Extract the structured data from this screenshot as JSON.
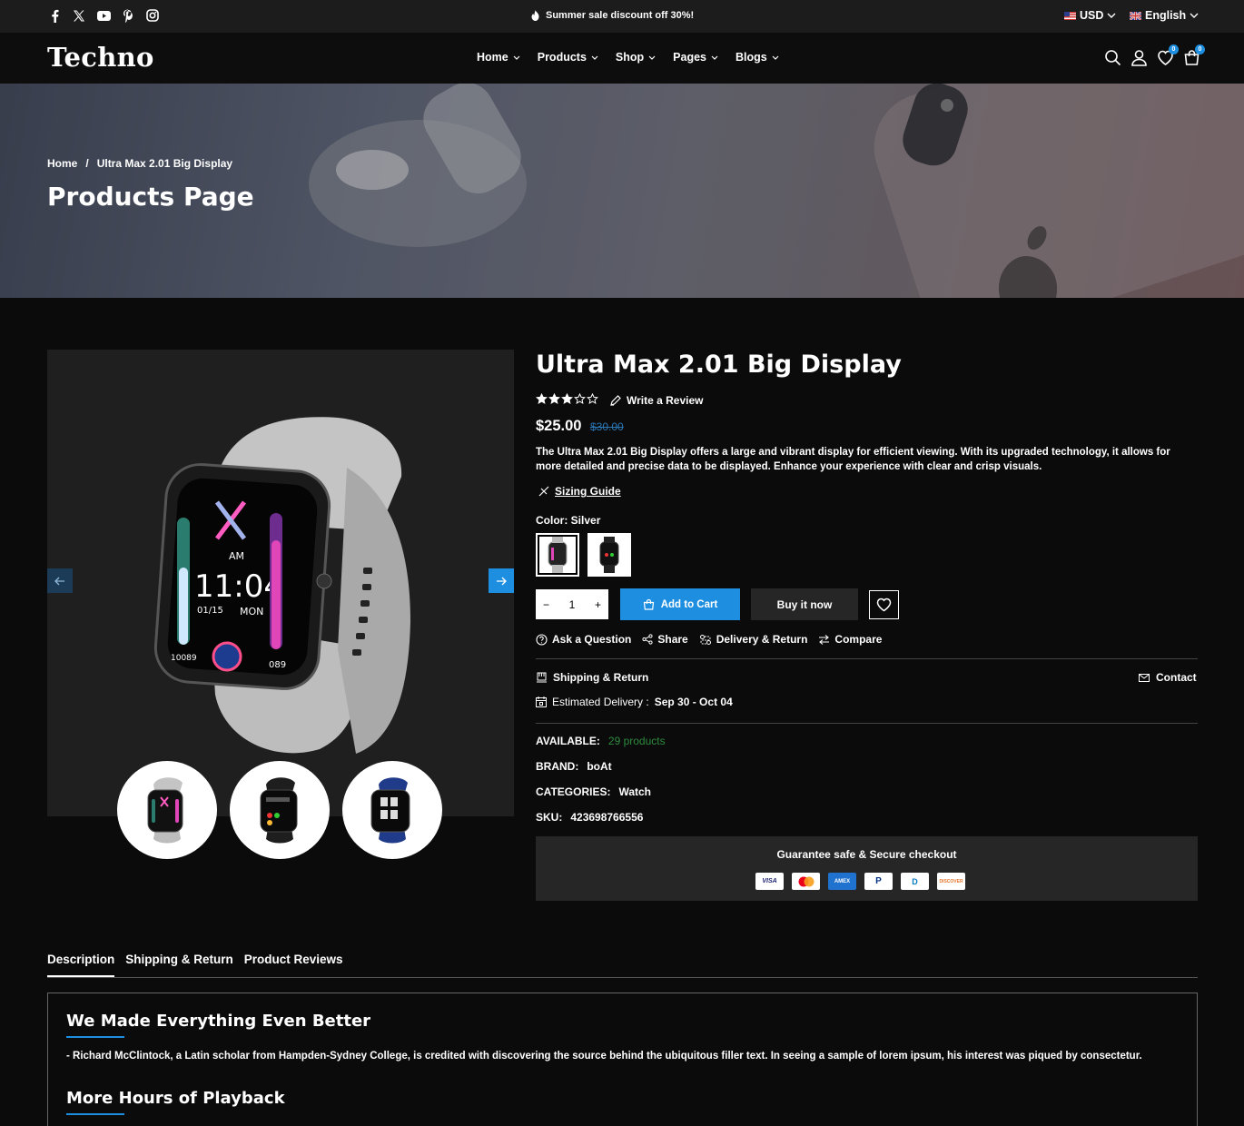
{
  "topbar": {
    "promo": "Summer sale discount off 30%!",
    "currency": "USD",
    "language": "English"
  },
  "header": {
    "logo": "Techno",
    "nav": [
      "Home",
      "Products",
      "Shop",
      "Pages",
      "Blogs"
    ],
    "wishlist_count": "0",
    "cart_count": "0"
  },
  "hero": {
    "breadcrumb_home": "Home",
    "breadcrumb_sep": "/",
    "breadcrumb_current": "Ultra Max 2.01 Big Display",
    "title": "Products Page"
  },
  "product": {
    "title": "Ultra Max 2.01 Big Display",
    "rating": 3,
    "rating_max": 5,
    "write_review": "Write a Review",
    "price": "$25.00",
    "old_price": "$30.00",
    "description": "The Ultra Max 2.01 Big Display offers a large and vibrant display for efficient viewing. With its upgraded technology, it allows for more detailed and precise data to be displayed. Enhance your experience with clear and crisp visuals.",
    "sizing_guide": "Sizing Guide",
    "color_label": "Color:",
    "color_value": "Silver",
    "quantity": "1",
    "add_to_cart": "Add to Cart",
    "buy_now": "Buy it now",
    "actions": [
      "Ask a Question",
      "Share",
      "Delivery & Return",
      "Compare"
    ],
    "shipping_return": "Shipping & Return",
    "contact": "Contact",
    "estimated_label": "Estimated Delivery :",
    "estimated_value": "Sep 30 - Oct 04",
    "available_label": "AVAILABLE:",
    "available_value": "29 products",
    "brand_label": "BRAND:",
    "brand_value": "boAt",
    "categories_label": "CATEGORIES:",
    "categories_value": "Watch",
    "sku_label": "SKU:",
    "sku_value": "423698766556",
    "guarantee": "Guarantee safe & Secure checkout",
    "payment_cards": [
      "VISA",
      "",
      "AMEX",
      "P",
      "D",
      "DISCOVER"
    ]
  },
  "tabs": [
    "Description",
    "Shipping & Return",
    "Product Reviews"
  ],
  "description_section": {
    "heading1": "We Made Everything Even Better",
    "text1": "- Richard McClintock, a Latin scholar from Hampden-Sydney College, is credited with discovering the source behind the ubiquitous filler text. In seeing a sample of lorem ipsum, his interest was piqued by consectetur.",
    "heading2": "More Hours of Playback"
  },
  "colors": {
    "accent": "#1e8fe0",
    "available_green": "#2e8b3d",
    "old_price": "#2a77b5"
  }
}
